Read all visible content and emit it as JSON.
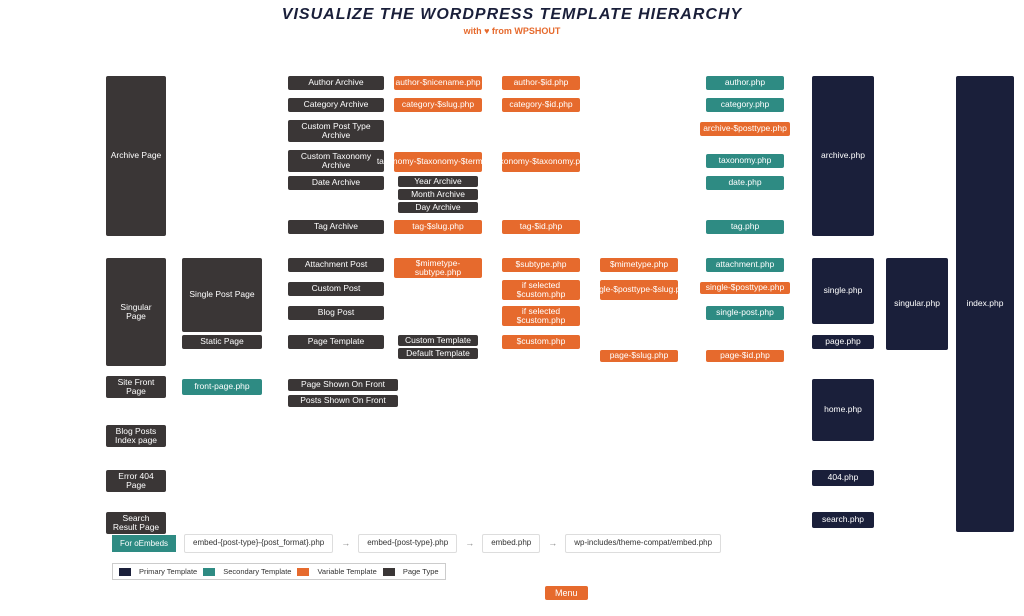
{
  "header": {
    "title": "VISUALIZE THE WORDPRESS TEMPLATE HIERARCHY",
    "subtitle_prefix": "with ♥ from ",
    "subtitle_brand": "WPSHOUT"
  },
  "legend": {
    "primary": "Primary Template",
    "secondary": "Secondary Template",
    "variable": "Variable Template",
    "pagetype": "Page Type"
  },
  "embeds": {
    "label": "For oEmbeds",
    "steps": [
      "embed-{post-type}-{post_format}.php",
      "embed-{post-type}.php",
      "embed.php",
      "wp-includes/theme-compat/embed.php"
    ]
  },
  "menu": "Menu",
  "boxes": {
    "archive_page": "Archive Page",
    "author_archive": "Author Archive",
    "category_archive": "Category Archive",
    "cpt_archive": "Custom Post Type Archive",
    "ctax_archive": "Custom Taxonomy Archive",
    "date_archive": "Date Archive",
    "year_archive": "Year Archive",
    "month_archive": "Month Archive",
    "day_archive": "Day Archive",
    "tag_archive": "Tag Archive",
    "author_nicename": "author-$nicename.php",
    "author_id": "author-$id.php",
    "category_slug": "category-$slug.php",
    "category_id": "category-$id.php",
    "archive_posttype": "archive-$posttype.php",
    "taxonomy_term": "taxonomy-$taxonomy-$term.php",
    "taxonomy_tax": "taxonomy-$taxonomy.php",
    "tag_slug": "tag-$slug.php",
    "tag_id": "tag-$id.php",
    "author_php": "author.php",
    "category_php": "category.php",
    "taxonomy_php": "taxonomy.php",
    "date_php": "date.php",
    "tag_php": "tag.php",
    "archive_php": "archive.php",
    "index_php": "index.php",
    "singular_page": "Singular Page",
    "single_post_page": "Single Post Page",
    "static_page": "Static Page",
    "attachment_post": "Attachment Post",
    "custom_post": "Custom Post",
    "blog_post": "Blog Post",
    "page_template": "Page Template",
    "custom_template": "Custom Template",
    "default_template": "Default Template",
    "mimetype_subtype": "$mimetype-subtype.php",
    "subtype_php": "$subtype.php",
    "if_selected_custom": "if selected $custom.php",
    "if_selected_custom2": "if selected $custom.php",
    "custom_php": "$custom.php",
    "mimetype_php": "$mimetype.php",
    "single_posttype_slug": "single-$posttype-$slug.php",
    "page_slug": "page-$slug.php",
    "page_id": "page-$id.php",
    "attachment_php": "attachment.php",
    "single_posttype": "single-$posttype.php",
    "single_post_php": "single-post.php",
    "single_php": "single.php",
    "singular_php": "singular.php",
    "page_php": "page.php",
    "site_front_page": "Site Front Page",
    "front_page_php": "front-page.php",
    "page_shown_front": "Page Shown On Front",
    "posts_shown_front": "Posts Shown On Front",
    "home_php": "home.php",
    "blog_posts_index": "Blog Posts Index page",
    "error_404": "Error 404 Page",
    "page_404": "404.php",
    "search_result": "Search Result Page",
    "search_php": "search.php"
  }
}
